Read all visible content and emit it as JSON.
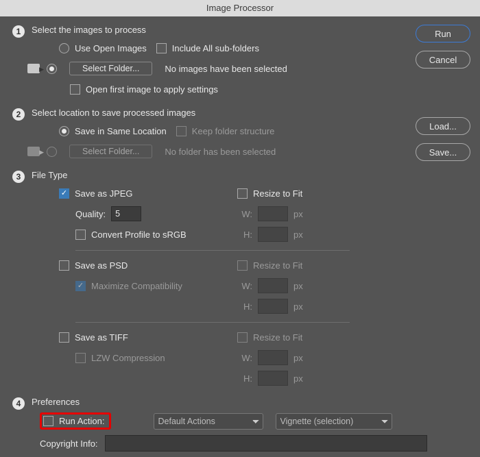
{
  "title": "Image Processor",
  "sidebar": {
    "run": "Run",
    "cancel": "Cancel",
    "load": "Load...",
    "save": "Save..."
  },
  "s1": {
    "heading": "Select the images to process",
    "use_open": "Use Open Images",
    "include_sub": "Include All sub-folders",
    "select_folder": "Select Folder...",
    "status": "No images have been selected",
    "open_first": "Open first image to apply settings"
  },
  "s2": {
    "heading": "Select location to save processed images",
    "same_loc": "Save in Same Location",
    "keep_struct": "Keep folder structure",
    "select_folder": "Select Folder...",
    "status": "No folder has been selected"
  },
  "s3": {
    "heading": "File Type",
    "jpeg": "Save as JPEG",
    "quality_label": "Quality:",
    "quality_value": "5",
    "convert_srgb": "Convert Profile to sRGB",
    "psd": "Save as PSD",
    "max_compat": "Maximize Compatibility",
    "tiff": "Save as TIFF",
    "lzw": "LZW Compression",
    "resize": "Resize to Fit",
    "w": "W:",
    "h": "H:",
    "px": "px"
  },
  "s4": {
    "heading": "Preferences",
    "run_action": "Run Action:",
    "action_set": "Default Actions",
    "action": "Vignette (selection)",
    "copyright": "Copyright Info:"
  }
}
